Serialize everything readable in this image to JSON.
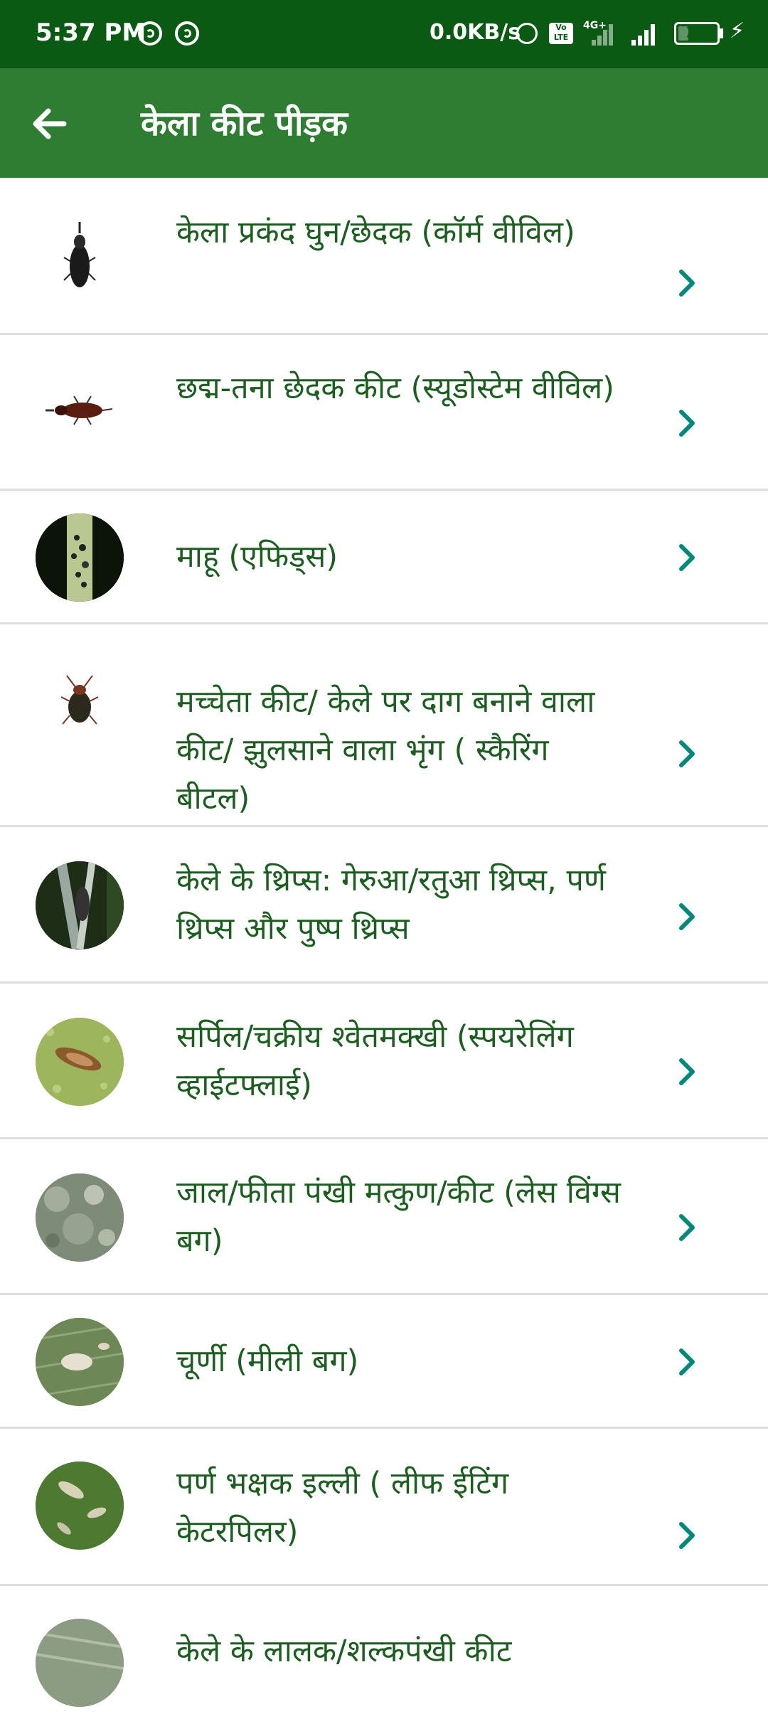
{
  "status_bar": {
    "time": "5:37 PM",
    "speed": "0.0KB/s",
    "network": "4G+",
    "volte": "Vo LTE",
    "battery": "27",
    "battery_level": 0.27
  },
  "app_bar": {
    "back_icon": "arrow-left-icon",
    "title": "केला कीट पीड़क"
  },
  "pests": [
    {
      "label": "केला प्रकंद घुन/छेदक (कॉर्म वीविल)",
      "thumb": "corm-weevil-image"
    },
    {
      "label": "छद्म-तना छेदक कीट (स्यूडोस्टेम वीविल)",
      "thumb": "pseudostem-weevil-image"
    },
    {
      "label": "माहू (एफिड्स)",
      "thumb": "aphids-image"
    },
    {
      "label": "मच्चेता कीट/ केले पर दाग बनाने वाला कीट/ झुलसाने वाला भृंग ( स्कैरिंग बीटल)",
      "thumb": "scarring-beetle-image"
    },
    {
      "label": "केले के थ्रिप्स: गेरुआ/रतुआ थ्रिप्स, पर्ण थ्रिप्स और पुष्प थ्रिप्स",
      "thumb": "thrips-image"
    },
    {
      "label": "सर्पिल/चक्रीय श्वेतमक्खी (स्पयरेलिंग व्हाईटफ्लाई)",
      "thumb": "whitefly-image"
    },
    {
      "label": "जाल/फीता पंखी मत्कुण/कीट (लेस विंग्स बग)",
      "thumb": "lace-wing-bug-image"
    },
    {
      "label": "चूर्णी (मीली बग)",
      "thumb": "mealybug-image"
    },
    {
      "label": "पर्ण भक्षक इल्ली ( लीफ ईटिंग केटरपिलर)",
      "thumb": "leaf-eating-caterpillar-image"
    },
    {
      "label": "केले के लालक/शल्कपंखी कीट",
      "thumb": "scale-insect-image"
    }
  ],
  "colors": {
    "status_bar": "#0b5a14",
    "app_bar": "#2e7d32",
    "item_text": "#1b5e20",
    "chevron": "#00897b"
  }
}
